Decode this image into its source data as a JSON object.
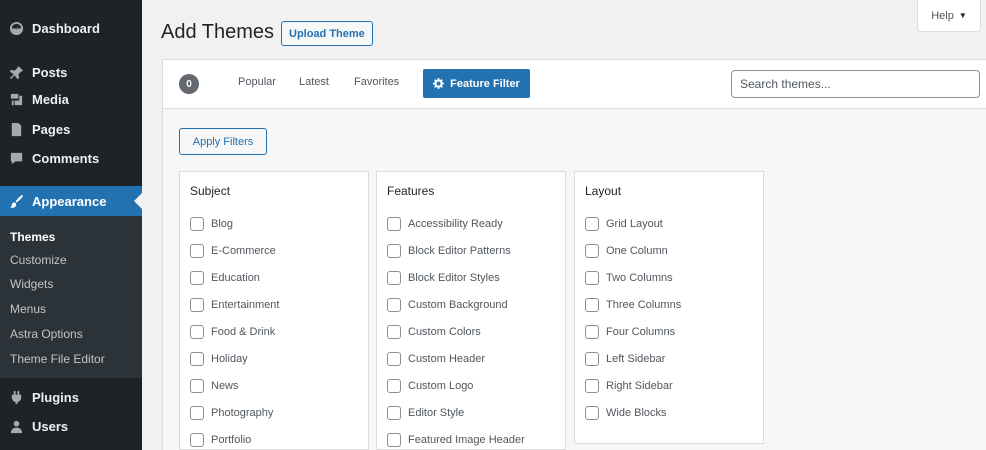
{
  "sidebar": {
    "items": [
      {
        "label": "Dashboard",
        "icon": "dashboard-icon"
      },
      {
        "label": "Posts",
        "icon": "pin-icon"
      },
      {
        "label": "Media",
        "icon": "media-icon"
      },
      {
        "label": "Pages",
        "icon": "pages-icon"
      },
      {
        "label": "Comments",
        "icon": "comment-icon"
      },
      {
        "label": "Appearance",
        "icon": "paintbrush-icon",
        "active": true
      },
      {
        "label": "Plugins",
        "icon": "plugin-icon"
      },
      {
        "label": "Users",
        "icon": "users-icon"
      }
    ],
    "submenu": [
      "Themes",
      "Customize",
      "Widgets",
      "Menus",
      "Astra Options",
      "Theme File Editor"
    ]
  },
  "header": {
    "title": "Add Themes",
    "upload_label": "Upload Theme",
    "help_label": "Help"
  },
  "filter_bar": {
    "count": "0",
    "links": [
      "Popular",
      "Latest",
      "Favorites"
    ],
    "feature_filter_label": "Feature Filter",
    "search_placeholder": "Search themes..."
  },
  "drawer": {
    "apply_label": "Apply Filters",
    "groups": [
      {
        "title": "Subject",
        "options": [
          "Blog",
          "E-Commerce",
          "Education",
          "Entertainment",
          "Food & Drink",
          "Holiday",
          "News",
          "Photography",
          "Portfolio"
        ]
      },
      {
        "title": "Features",
        "options": [
          "Accessibility Ready",
          "Block Editor Patterns",
          "Block Editor Styles",
          "Custom Background",
          "Custom Colors",
          "Custom Header",
          "Custom Logo",
          "Editor Style",
          "Featured Image Header"
        ]
      },
      {
        "title": "Layout",
        "options": [
          "Grid Layout",
          "One Column",
          "Two Columns",
          "Three Columns",
          "Four Columns",
          "Left Sidebar",
          "Right Sidebar",
          "Wide Blocks"
        ]
      }
    ]
  },
  "colors": {
    "sidebar_bg": "#1d2327",
    "accent": "#2271b1",
    "page_bg": "#f1f1f1"
  }
}
